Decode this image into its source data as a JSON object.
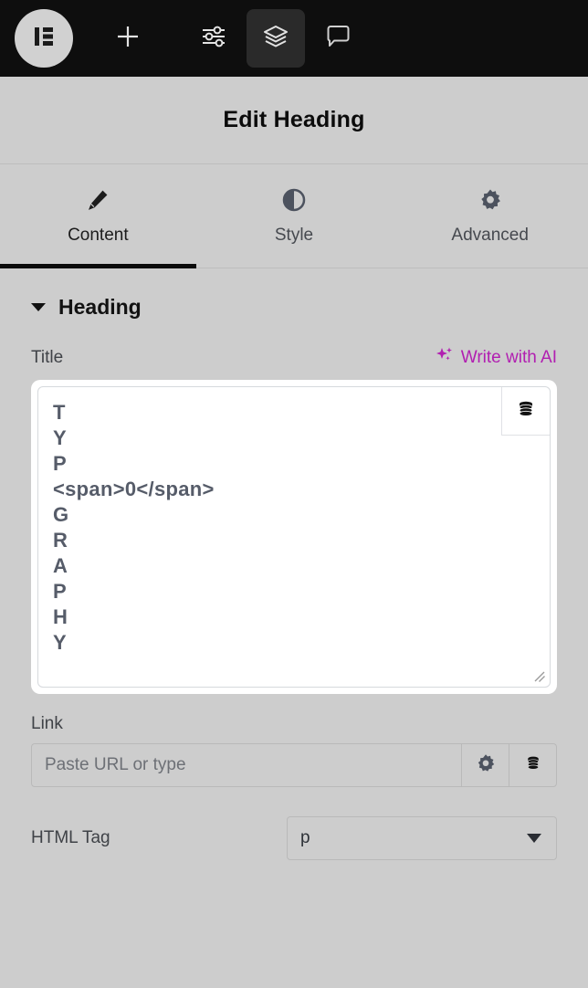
{
  "toolbar": {
    "logo": "elementor-logo",
    "buttons": [
      {
        "name": "add-element-button",
        "icon": "plus-icon"
      },
      {
        "name": "site-settings-button",
        "icon": "sliders-icon"
      },
      {
        "name": "structure-button",
        "icon": "layers-icon",
        "active": true
      },
      {
        "name": "comments-button",
        "icon": "speech-bubble-icon"
      }
    ]
  },
  "panel": {
    "title": "Edit Heading",
    "tabs": [
      {
        "label": "Content",
        "icon": "pencil-icon",
        "active": true
      },
      {
        "label": "Style",
        "icon": "contrast-icon",
        "active": false
      },
      {
        "label": "Advanced",
        "icon": "gear-icon",
        "active": false
      }
    ]
  },
  "section": {
    "title": "Heading",
    "expanded": true
  },
  "title_field": {
    "label": "Title",
    "ai_label": "Write with AI",
    "ai_color": "#b11fb1",
    "value": "T\nY\nP\n<span>0</span>\nG\nR\nA\nP\nH\nY",
    "dynamic_icon": "database-icon"
  },
  "link_field": {
    "label": "Link",
    "placeholder": "Paste URL or type",
    "value": "",
    "options_icon": "gear-icon",
    "dynamic_icon": "database-icon"
  },
  "html_tag_field": {
    "label": "HTML Tag",
    "value": "p"
  }
}
